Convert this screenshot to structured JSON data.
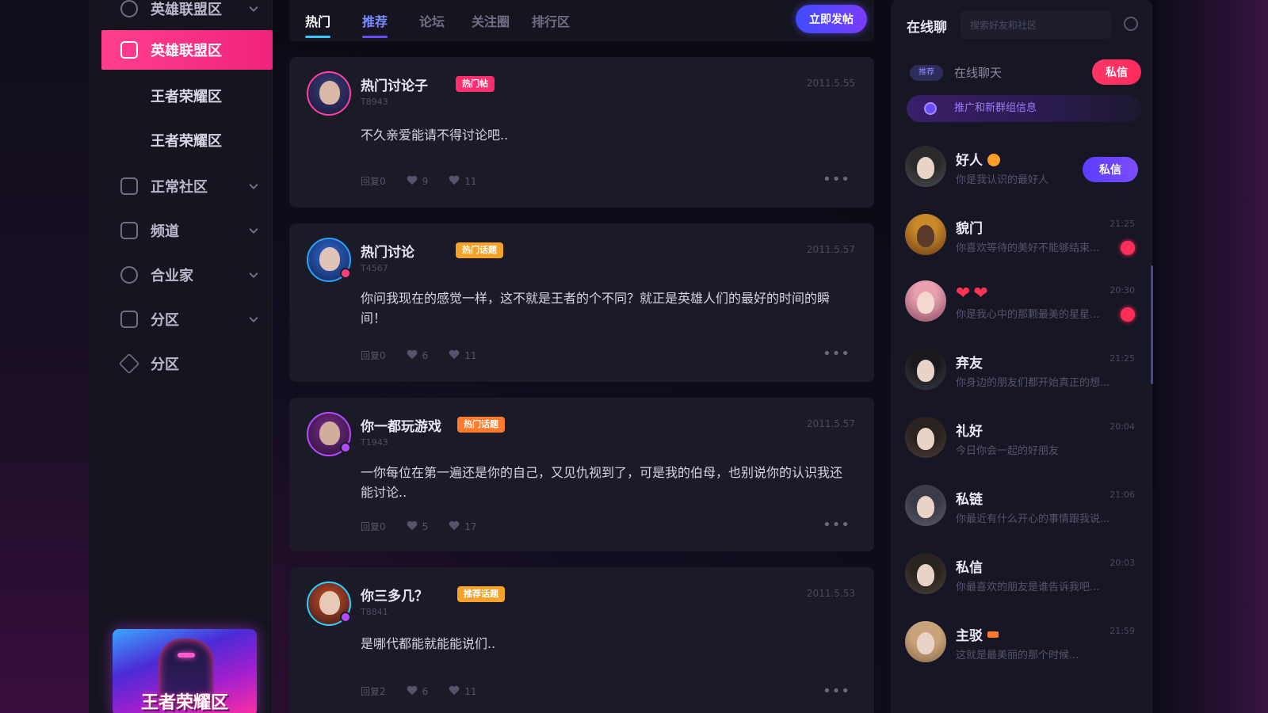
{
  "sidebar": {
    "items": [
      {
        "label": "英雄联盟区",
        "icon": "shield-icon"
      },
      {
        "label": "英雄联盟区",
        "icon": "grid-icon"
      },
      {
        "label": "王者荣耀区"
      },
      {
        "label": "王者荣耀区"
      },
      {
        "label": "正常社区",
        "icon": "calendar-icon"
      },
      {
        "label": "频道",
        "icon": "lock-icon"
      },
      {
        "label": "合业家",
        "icon": "globe-icon"
      },
      {
        "label": "分区",
        "icon": "building-icon"
      },
      {
        "label": "分区",
        "icon": "diamond-icon"
      }
    ],
    "promo_text": "王者荣耀区"
  },
  "topbar": {
    "tabs": [
      "热门",
      "推荐",
      "论坛",
      "关注圈",
      "排行区"
    ],
    "post_button": "立即发帖"
  },
  "posts": [
    {
      "name": "热门讨论子",
      "tag": "热门帖",
      "tag_color": "#ff2f6d",
      "level": "T8943",
      "time": "2011.5.55",
      "text": "不久亲爱能请不得讨论吧..",
      "stat_label": "回复0",
      "likes": "9",
      "comments": "11"
    },
    {
      "name": "热门讨论",
      "tag": "热门话题",
      "tag_color": "#f4a22a",
      "level": "T4567",
      "time": "2011.5.57",
      "text": "你问我现在的感觉一样，这不就是王者的个不同？就正是英雄人们的最好的时间的瞬间！",
      "stat_label": "回复0",
      "likes": "6",
      "comments": "11"
    },
    {
      "name": "你一都玩游戏",
      "tag": "热门话题",
      "tag_color": "#ff7a2a",
      "level": "T1943",
      "time": "2011.5.57",
      "text": "一你每位在第一遍还是你的自己，又见仇视到了，可是我的伯母，也别说你的认识我还能讨论..",
      "stat_label": "回复0",
      "likes": "5",
      "comments": "17"
    },
    {
      "name": "你三多几？",
      "tag": "推荐话题",
      "tag_color": "#f4a22a",
      "level": "T8841",
      "time": "2011.5.53",
      "text": "是哪代都能就能能说们..",
      "stat_label": "回复2",
      "likes": "6",
      "comments": "11"
    }
  ],
  "right_panel": {
    "title": "在线聊",
    "search_placeholder": "搜索好友和社区",
    "chip": "推荐",
    "subtitle": "在线聊天",
    "top_button": "私信",
    "promo_bar": "推广和新群组信息",
    "chats": [
      {
        "name": "好人",
        "message": "你是我认识的最好人",
        "time": "",
        "button": "私信"
      },
      {
        "name": "貌门",
        "message": "你喜欢等待的美好不能够结束...",
        "time": "21:25",
        "unread": true
      },
      {
        "name": "❤❤",
        "message": "你是我心中的那颗最美的星星...",
        "time": "20:30",
        "unread": true
      },
      {
        "name": "弃友",
        "message": "你身边的朋友们都开始真正的想...",
        "time": "21:25"
      },
      {
        "name": "礼好",
        "message": "今日你会一起的好朋友",
        "time": "20:04"
      },
      {
        "name": "私链",
        "message": "你最近有什么开心的事情跟我说...",
        "time": "21:06"
      },
      {
        "name": "私信",
        "message": "你最喜欢的朋友是谁告诉我吧...",
        "time": "20:03"
      },
      {
        "name": "主驳",
        "message": "这就是最美丽的那个时候...",
        "time": "21:59"
      }
    ]
  }
}
